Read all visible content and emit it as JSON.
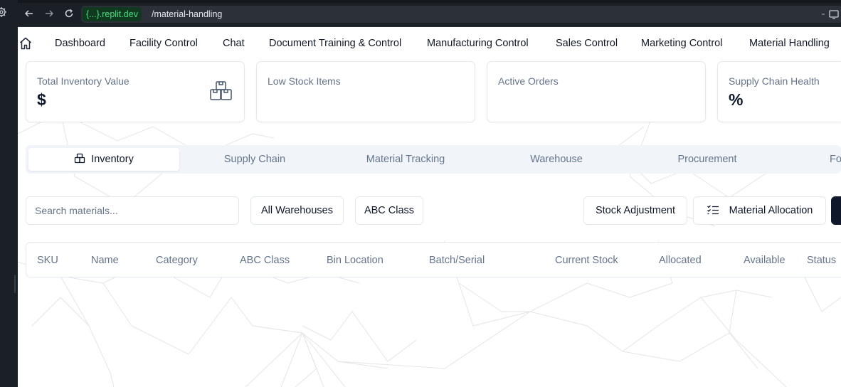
{
  "browser": {
    "url_host": "{...}.replit.dev",
    "url_path": "/material-handling"
  },
  "nav": {
    "items": [
      "Dashboard",
      "Facility Control",
      "Chat",
      "Document Training & Control",
      "Manufacturing Control",
      "Sales Control",
      "Marketing Control",
      "Material Handling"
    ]
  },
  "cards": [
    {
      "title": "Total Inventory Value",
      "value": "$",
      "icon": "boxes-icon"
    },
    {
      "title": "Low Stock Items",
      "value": ""
    },
    {
      "title": "Active Orders",
      "value": ""
    },
    {
      "title": "Supply Chain Health",
      "value": "%"
    }
  ],
  "tabs": [
    "Inventory",
    "Supply Chain",
    "Material Tracking",
    "Warehouse",
    "Procurement",
    "Fo"
  ],
  "toolbar": {
    "search_placeholder": "Search materials...",
    "warehouse_filter": "All Warehouses",
    "abc_filter": "ABC Class",
    "stock_adjustment": "Stock Adjustment",
    "material_allocation": "Material Allocation"
  },
  "table": {
    "headers": [
      "SKU",
      "Name",
      "Category",
      "ABC Class",
      "Bin Location",
      "Batch/Serial",
      "Current Stock",
      "Allocated",
      "Available",
      "Status"
    ]
  },
  "colors": {
    "accent_dark": "#0f172a",
    "muted_text": "#64748b",
    "border": "#e2e8f0",
    "url_host_text": "#4ade80"
  }
}
